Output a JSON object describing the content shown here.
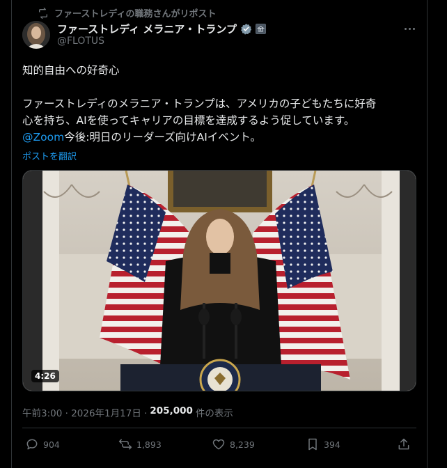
{
  "repost_label": "ファーストレディの職務さんがリポスト",
  "author": {
    "display_name": "ファーストレディ メラニア・トランプ",
    "handle": "@FLOTUS"
  },
  "post": {
    "line1": "知的自由への好奇心",
    "line2a": "ファーストレディのメラニア・トランプは、アメリカの子どもたちに好奇",
    "line2b": "心を持ち、AIを使ってキャリアの目標を達成するよう促しています。",
    "mention": "@Zoom",
    "line3_rest": "今後:明日のリーダーズ向けAIイベント。",
    "translate_label": "ポストを翻訳"
  },
  "video": {
    "duration": "4:26"
  },
  "meta": {
    "timestamp": "午前3:00 · 2026年1月17日 ·",
    "views_count": "205,000",
    "views_label": "件の表示"
  },
  "actions": {
    "replies": "904",
    "reposts": "1,893",
    "likes": "8,239",
    "bookmarks": "394"
  },
  "colors": {
    "background": "#000000",
    "text_primary": "#e7e9ea",
    "text_secondary": "#71767b",
    "link": "#1d9bf0",
    "divider": "#2f3336",
    "verified_badge": "#829aab"
  }
}
